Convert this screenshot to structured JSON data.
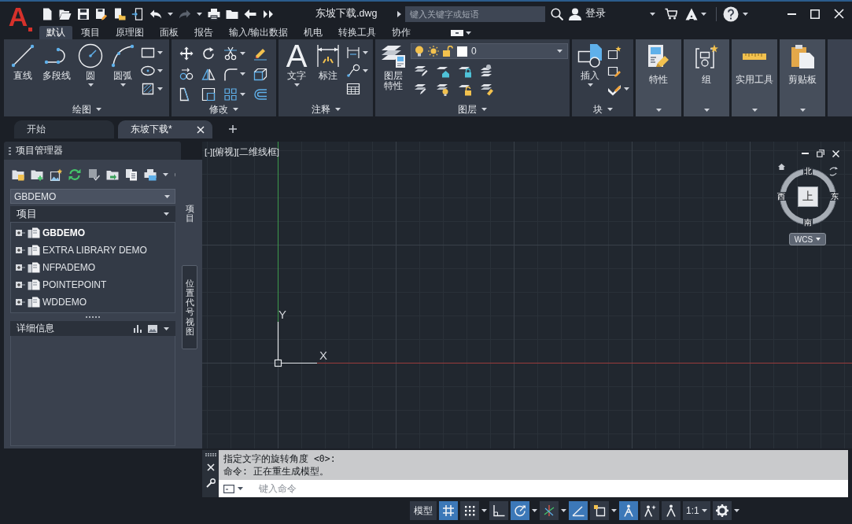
{
  "title_bar": {
    "logo": "A",
    "quick_access": [
      {
        "kind": "new",
        "disabled": false
      },
      {
        "kind": "open",
        "disabled": false
      },
      {
        "kind": "save",
        "disabled": false
      },
      {
        "kind": "saveas",
        "disabled": false
      },
      {
        "kind": "sheet",
        "disabled": false
      },
      {
        "kind": "share",
        "disabled": false
      },
      {
        "kind": "undo",
        "disabled": false
      },
      {
        "kind": "redo",
        "disabled": true
      },
      {
        "kind": "print",
        "disabled": false
      },
      {
        "kind": "folder",
        "disabled": false
      },
      {
        "kind": "back",
        "disabled": false
      },
      {
        "kind": "more",
        "disabled": false
      }
    ],
    "file_name": "东坡下载.dwg",
    "search": {
      "placeholder": "键入关键字或短语"
    },
    "sign_in": "登录"
  },
  "ribbon_tabs": [
    {
      "label": "默认",
      "selected": true
    },
    {
      "label": "项目",
      "selected": false
    },
    {
      "label": "原理图",
      "selected": false
    },
    {
      "label": "面板",
      "selected": false
    },
    {
      "label": "报告",
      "selected": false
    },
    {
      "label": "输入/输出数据",
      "selected": false
    },
    {
      "label": "机电",
      "selected": false
    },
    {
      "label": "转换工具",
      "selected": false
    },
    {
      "label": "协作",
      "selected": false
    }
  ],
  "ribbon_panels": [
    {
      "kind": "draw",
      "title": "绘图",
      "tools": [
        {
          "label": "直线",
          "dropdown": false
        },
        {
          "label": "多段线",
          "dropdown": false
        },
        {
          "label": "圆",
          "dropdown": true
        },
        {
          "label": "圆弧",
          "dropdown": true
        }
      ]
    },
    {
      "kind": "modify",
      "title": "修改"
    },
    {
      "kind": "annotation",
      "title": "注释",
      "tools": [
        {
          "label": "文字",
          "glyph": "A",
          "dropdown": true
        },
        {
          "label": "标注",
          "dropdown": false
        }
      ]
    },
    {
      "kind": "layers",
      "title": "图层",
      "current_layer": "0",
      "tools": [
        {
          "label": "图层特性",
          "dropdown": false
        }
      ]
    },
    {
      "kind": "block",
      "title": "块",
      "tools": [
        {
          "label": "插入",
          "dropdown": true
        }
      ]
    },
    {
      "kind": "properties",
      "title": "特性"
    },
    {
      "kind": "groups",
      "title": "组"
    },
    {
      "kind": "utilities",
      "title": "实用工具"
    },
    {
      "kind": "clipboard",
      "title": "剪贴板"
    }
  ],
  "document_tabs": [
    {
      "label": "开始",
      "selected": false
    },
    {
      "label": "东坡下载*",
      "selected": true
    }
  ],
  "project_manager": {
    "title": "项目管理器",
    "project": "GBDEMO",
    "section": "项目",
    "projects": [
      {
        "label": "GBDEMO",
        "active": true,
        "expanded": false
      },
      {
        "label": "EXTRA LIBRARY DEMO",
        "active": false,
        "expanded": false
      },
      {
        "label": "NFPADEMO",
        "active": false,
        "expanded": false
      },
      {
        "label": "POINTEPOINT",
        "active": false,
        "expanded": false
      },
      {
        "label": "WDDEMO",
        "active": false,
        "expanded": false
      }
    ],
    "details_title": "详细信息",
    "side_tabs": [
      {
        "label": "项目",
        "selected": true
      },
      {
        "label": "位置代号视图",
        "selected": false
      }
    ]
  },
  "viewport": {
    "label": "[-][俯视][二维线框]",
    "view_cube": {
      "face": "上",
      "north": "北",
      "south": "南",
      "west": "西",
      "east": "东",
      "ucs": "WCS"
    },
    "axes": {
      "x": "X",
      "y": "Y"
    }
  },
  "command_line": {
    "history": [
      "指定文字的旋转角度 <0>:",
      "命令: 正在重生成模型。"
    ],
    "placeholder": "键入命令"
  },
  "status_bar": {
    "model": "模型",
    "toggles": [
      {
        "kind": "grid",
        "on": true
      },
      {
        "kind": "snap",
        "on": false
      },
      {
        "kind": "ortho",
        "on": false
      },
      {
        "kind": "polar",
        "on": true
      },
      {
        "kind": "isodraft",
        "on": false
      },
      {
        "kind": "dynamic",
        "on": true
      },
      {
        "kind": "osnap",
        "on": false
      },
      {
        "kind": "annotation",
        "on": true
      },
      {
        "kind": "autoscale",
        "on": false
      },
      {
        "kind": "visibility",
        "on": false
      }
    ],
    "scale": "1:1"
  }
}
